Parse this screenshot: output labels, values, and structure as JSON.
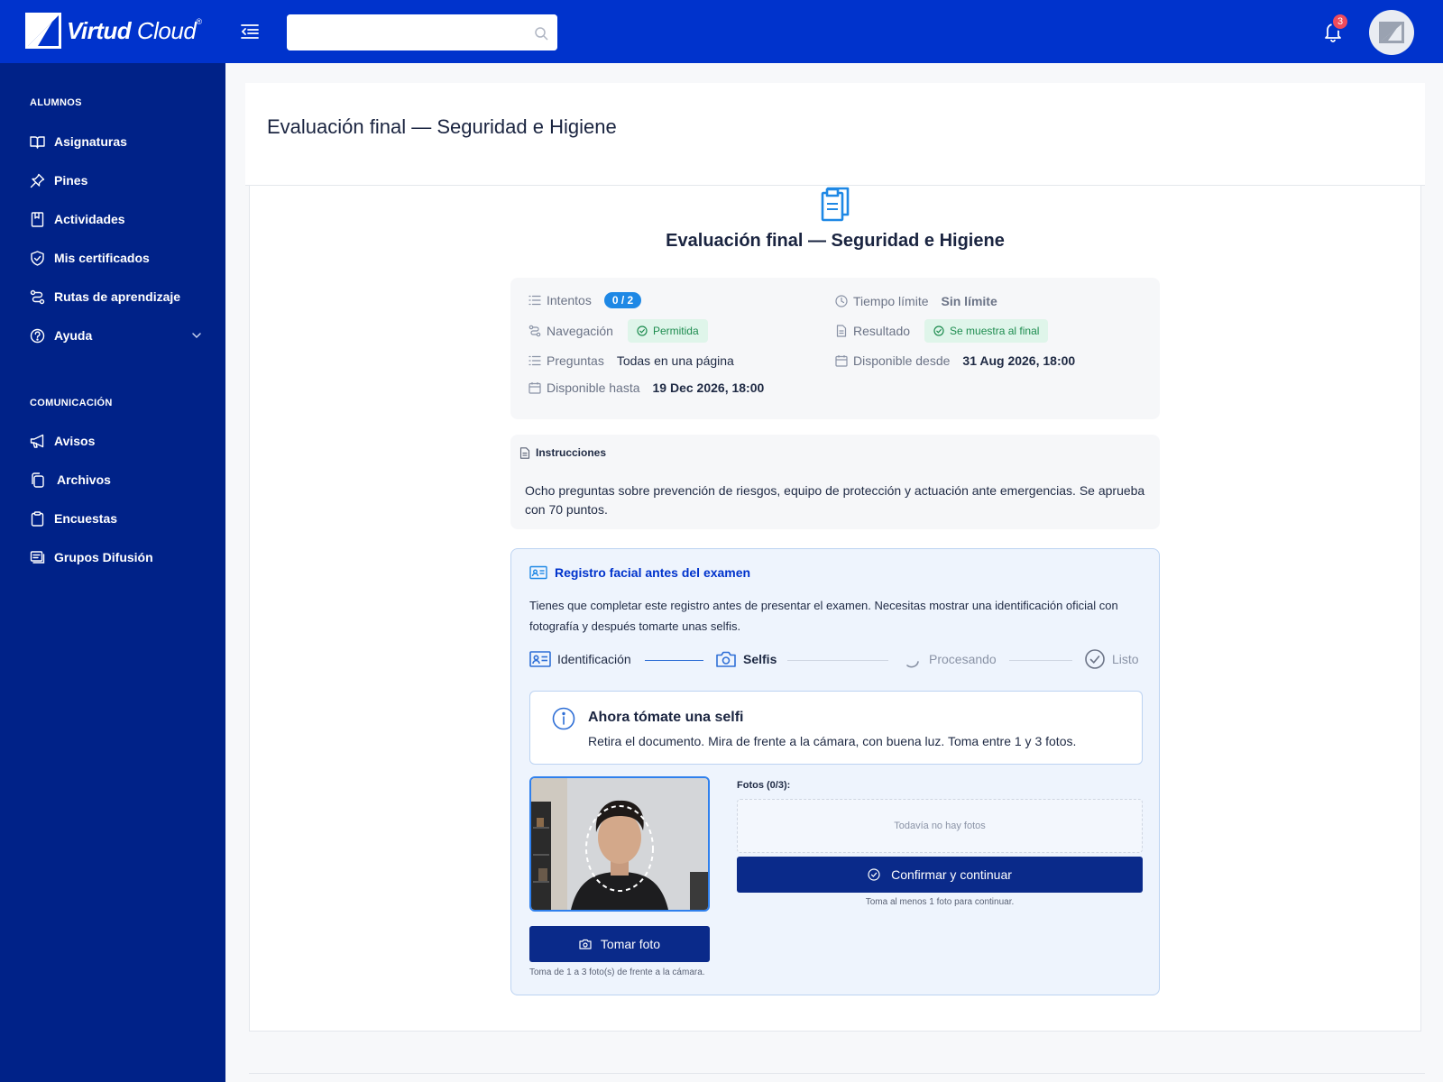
{
  "brand": {
    "name_bold": "Virtud",
    "name_light": "Cloud",
    "mark": "®"
  },
  "header": {
    "search": {
      "placeholder": "",
      "value": ""
    },
    "notifications": {
      "count": "3"
    }
  },
  "sidebar": {
    "sections": [
      {
        "title": "ALUMNOS",
        "items": [
          {
            "label": "Asignaturas",
            "icon": "book-icon"
          },
          {
            "label": "Pines",
            "icon": "pin-icon"
          },
          {
            "label": "Actividades",
            "icon": "bookmark-icon"
          },
          {
            "label": "Mis certificados",
            "icon": "shield-icon"
          },
          {
            "label": "Rutas de aprendizaje",
            "icon": "route-icon"
          },
          {
            "label": "Ayuda",
            "icon": "help-icon",
            "expandable": true
          }
        ]
      },
      {
        "title": "COMUNICACIÓN",
        "items": [
          {
            "label": "Avisos",
            "icon": "megaphone-icon"
          },
          {
            "label": "Archivos",
            "icon": "files-icon"
          },
          {
            "label": "Encuestas",
            "icon": "clipboard-icon"
          },
          {
            "label": "Grupos Difusión",
            "icon": "broadcast-icon"
          }
        ]
      }
    ]
  },
  "page": {
    "title": "Evaluación final — Seguridad e Higiene"
  },
  "exam": {
    "title": "Evaluación final — Seguridad e Higiene",
    "details": {
      "attempts": {
        "label": "Intentos",
        "value": "0 / 2"
      },
      "time_limit": {
        "label": "Tiempo límite",
        "value": "Sin límite"
      },
      "navigation": {
        "label": "Navegación",
        "value": "Permitida"
      },
      "result": {
        "label": "Resultado",
        "value": "Se muestra al final"
      },
      "questions": {
        "label": "Preguntas",
        "value": "Todas en una página"
      },
      "available_from": {
        "label": "Disponible desde",
        "value": "31 Aug 2026, 18:00"
      },
      "available_until": {
        "label": "Disponible hasta",
        "value": "19 Dec 2026, 18:00"
      }
    },
    "instructions": {
      "title": "Instrucciones",
      "text": "Ocho preguntas sobre prevención de riesgos, equipo de protección y actuación ante emergencias. Se aprueba con 70 puntos."
    }
  },
  "face_registration": {
    "title": "Registro facial antes del examen",
    "description": "Tienes que completar este registro antes de presentar el examen. Necesitas mostrar una identificación oficial con fotografía y después tomarte unas selfis.",
    "steps": [
      {
        "label": "Identificación",
        "state": "done"
      },
      {
        "label": "Selfis",
        "state": "active"
      },
      {
        "label": "Procesando",
        "state": "pending"
      },
      {
        "label": "Listo",
        "state": "pending"
      }
    ],
    "alert": {
      "title": "Ahora tómate una selfi",
      "text": "Retira el documento. Mira de frente a la cámara, con buena luz. Toma entre 1 y 3 fotos."
    },
    "take_photo_label": "Tomar foto",
    "take_photo_hint": "Toma de 1 a 3 foto(s) de frente a la cámara.",
    "photos_label": "Fotos (0/3):",
    "photos_empty": "Todavía no hay fotos",
    "confirm_label": "Confirmar y continuar",
    "confirm_hint": "Toma al menos 1 foto para continuar."
  },
  "colors": {
    "header": "#0033cc",
    "sidebar": "#002288",
    "primary_button": "#0a2a8a",
    "accent_blue": "#1e88e5",
    "success_green": "#1d8c4f",
    "badge_red": "#ef4b5b"
  }
}
